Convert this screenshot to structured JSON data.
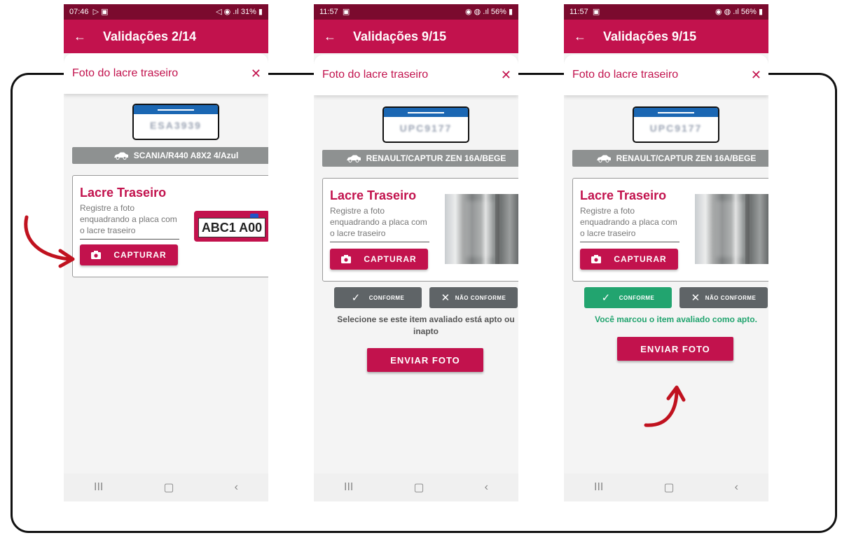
{
  "screens": [
    {
      "status": {
        "time": "07:46",
        "left_icons": "▷ ▣",
        "right": "◁ ◉ .ıl 31% ▮"
      },
      "appbar": {
        "title": "Validações 2/14"
      },
      "sheet": {
        "title": "Foto do lacre traseiro",
        "close": "✕"
      },
      "plate": "ESA3939",
      "vehicle": "SCANIA/R440 A8X2 4/Azul",
      "card": {
        "title": "Lacre Traseiro",
        "description": "Registre a foto enquadrando a placa com o lacre traseiro",
        "capture_label": "CAPTURAR",
        "example_plate": "ABC1 A00"
      }
    },
    {
      "status": {
        "time": "11:57",
        "left_icons": "▣",
        "right": "◉ ◍ .ıl 56% ▮"
      },
      "appbar": {
        "title": "Validações 9/15"
      },
      "sheet": {
        "title": "Foto do lacre traseiro",
        "close": "✕"
      },
      "plate": "UPC9177",
      "vehicle": "RENAULT/CAPTUR ZEN 16A/BEGE",
      "card": {
        "title": "Lacre Traseiro",
        "description": "Registre a foto enquadrando a placa com o lacre traseiro",
        "capture_label": "CAPTURAR"
      },
      "conforme_label": "CONFORME",
      "nao_conforme_label": "NÃO CONFORME",
      "hint": "Selecione se este item avaliado está apto ou inapto",
      "send_label": "ENVIAR FOTO"
    },
    {
      "status": {
        "time": "11:57",
        "left_icons": "▣",
        "right": "◉ ◍ .ıl 56% ▮"
      },
      "appbar": {
        "title": "Validações 9/15"
      },
      "sheet": {
        "title": "Foto do lacre traseiro",
        "close": "✕"
      },
      "plate": "UPC9177",
      "vehicle": "RENAULT/CAPTUR ZEN 16A/BEGE",
      "card": {
        "title": "Lacre Traseiro",
        "description": "Registre a foto enquadrando a placa com o lacre traseiro",
        "capture_label": "CAPTURAR"
      },
      "conforme_label": "CONFORME",
      "nao_conforme_label": "NÃO CONFORME",
      "hint": "Você marcou o item avaliado como apto.",
      "send_label": "ENVIAR FOTO"
    }
  ],
  "nav": {
    "recent": "III",
    "home": "▢",
    "back": "‹"
  },
  "colors": {
    "primary": "#c2124d",
    "status_bar": "#7b0a2e",
    "vehicle_bar": "#8e9191",
    "success": "#22a46f",
    "neutral_button": "#5f6467",
    "arrow": "#c0121f"
  }
}
